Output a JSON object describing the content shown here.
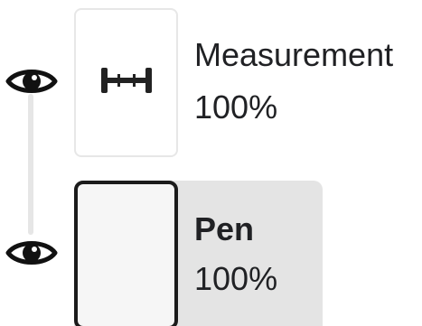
{
  "layers": [
    {
      "name": "Measurement",
      "opacity": "100%",
      "icon": "measurement-icon",
      "visible": true,
      "selected": false
    },
    {
      "name": "Pen",
      "opacity": "100%",
      "icon": "",
      "visible": true,
      "selected": true
    }
  ],
  "colors": {
    "selected_background": "#e4e4e4",
    "selected_border": "#1b1b1b",
    "thumb_border": "#e7e7e7",
    "text": "#202124",
    "connector": "#e6e6e6"
  }
}
